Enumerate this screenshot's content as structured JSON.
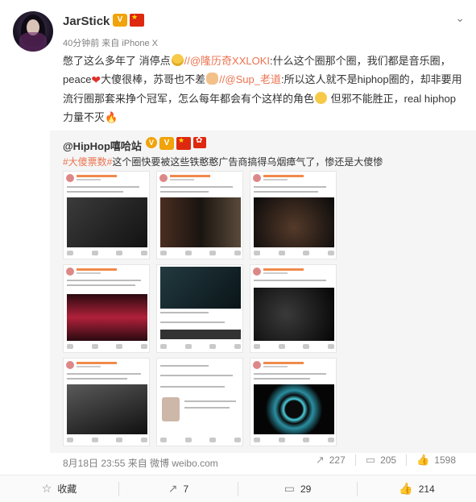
{
  "post": {
    "username": "JarStick",
    "meta": "40分钟前 来自 iPhone X",
    "text": {
      "p1": "憋了这么多年了 消停点",
      "link1": "//@隆历奇XXLOKI",
      "p2": ":什么这个圈那个圈，我们都是音乐圈，peace",
      "p3": "大傻很棒，苏哥也不差",
      "link2": "//@Sup_老道",
      "p4": ":所以这人就不是hiphop圈的，却非要用流行圈那套来挣个冠军，怎么每年都会有个这样的角色",
      "p5": " 但邪不能胜正，real hiphop力量不灭"
    }
  },
  "repost": {
    "username": "@HipHop嘻哈站",
    "topic": "#大傻票数#",
    "text": "这个圈快要被这些铁憨憨广告商搞得乌烟瘴气了，惨还是大傻惨",
    "timeline": "8月18日 23:55 来自 微博 weibo.com",
    "repost_count": "227",
    "comment_count": "205",
    "like_count": "1598"
  },
  "bottom": {
    "favorite_label": "收藏",
    "repost_count": "7",
    "comment_count": "29",
    "like_count": "214"
  },
  "icons": {
    "more": "chevron-down-icon",
    "repost": "repost-icon",
    "comment": "comment-icon",
    "like": "thumbs-up-icon",
    "favorite": "star-icon"
  },
  "colors": {
    "link": "#eb7350",
    "meta": "#808080",
    "repost_bg": "#f5f5f5"
  }
}
